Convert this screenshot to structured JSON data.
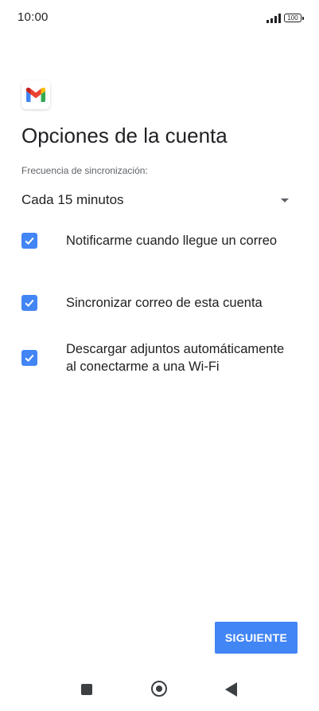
{
  "status_bar": {
    "time": "10:00",
    "battery": "100",
    "icons": [
      "signal-icon",
      "battery-icon"
    ]
  },
  "app": {
    "logo_icon": "gmail-logo-icon"
  },
  "page": {
    "title": "Opciones de la cuenta"
  },
  "sync": {
    "label": "Frecuencia de sincronización:",
    "selected_value": "Cada 15 minutos",
    "dropdown_icon": "dropdown-arrow-icon"
  },
  "options": [
    {
      "label": "Notificarme cuando llegue un correo",
      "checked": true
    },
    {
      "label": "Sincronizar correo de esta cuenta",
      "checked": true
    },
    {
      "label": "Descargar adjuntos automáticamente al conectarme a una Wi-Fi",
      "checked": true
    }
  ],
  "actions": {
    "next_label": "SIGUIENTE"
  },
  "nav_bar": {
    "icons": [
      "recents-icon",
      "home-icon",
      "back-icon"
    ]
  },
  "colors": {
    "accent": "#4285f4",
    "text": "#202124",
    "secondary_text": "#5f6368"
  }
}
